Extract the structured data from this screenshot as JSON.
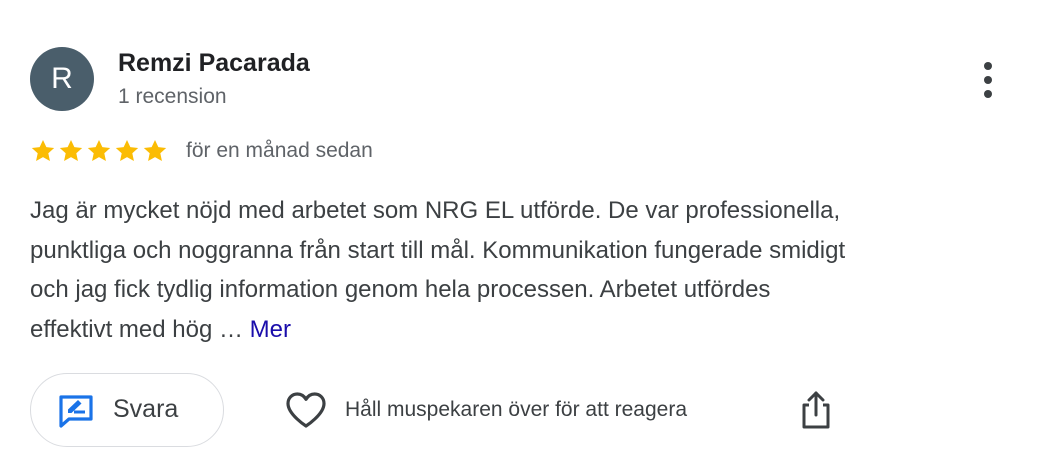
{
  "author": {
    "initial": "R",
    "name": "Remzi Pacarada",
    "meta": "1 recension",
    "avatar_color": "#4a5e6b"
  },
  "rating": {
    "stars": 5,
    "max_stars": 5,
    "star_color": "#fbbc04",
    "date": "för en månad sedan"
  },
  "review": {
    "lines": [
      "Jag är mycket nöjd med arbetet som NRG EL utförde. De var professionella,",
      "punktliga och noggranna från start till mål. Kommunikation fungerade smidigt",
      "och jag fick tydlig information genom hela processen. Arbetet utfördes",
      "effektivt med hög …"
    ],
    "more_label": "Mer",
    "link_color": "#1a0dab"
  },
  "actions": {
    "reply_label": "Svara",
    "react_label": "Håll muspekaren över för att reagera",
    "reply_icon_color": "#1a73e8"
  }
}
